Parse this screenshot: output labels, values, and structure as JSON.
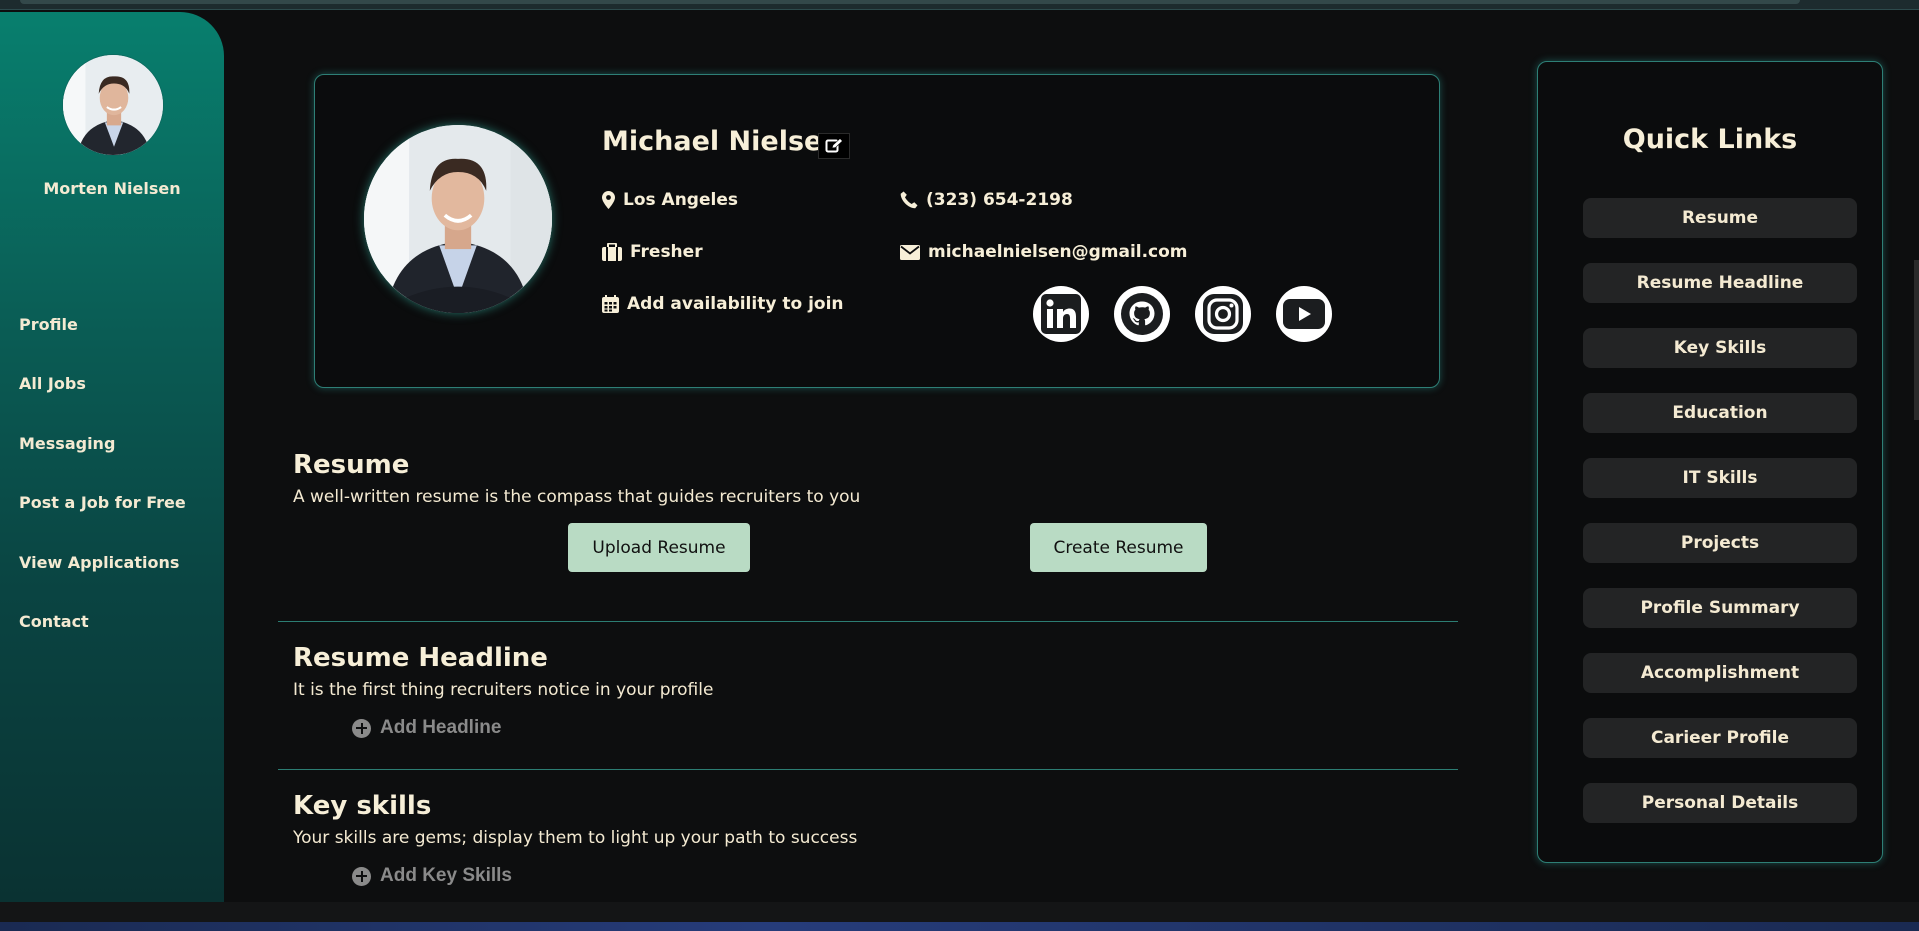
{
  "sidebar": {
    "user_name": "Morten Nielsen",
    "nav": [
      "Profile",
      "All Jobs",
      "Messaging",
      "Post a Job for Free",
      "View Applications",
      "Contact"
    ]
  },
  "profile": {
    "name": "Michael Nielsen",
    "location": "Los Angeles",
    "experience": "Fresher",
    "availability": "Add availability to join",
    "phone": "(323) 654-2198",
    "email": "michaelnielsen@gmail.com",
    "social_icons": [
      "linkedin-icon",
      "github-icon",
      "instagram-icon",
      "youtube-icon"
    ]
  },
  "sections": {
    "resume": {
      "title": "Resume",
      "subtitle": "A well-written resume is the compass that guides recruiters to you",
      "upload_label": "Upload Resume",
      "create_label": "Create Resume"
    },
    "headline": {
      "title": "Resume Headline",
      "subtitle": "It is the first thing recruiters notice in your profile",
      "add_label": "Add Headline"
    },
    "skills": {
      "title": "Key skills",
      "subtitle": "Your skills are gems; display them to light up your path to success",
      "add_label": "Add Key Skills"
    }
  },
  "quick_links": {
    "title": "Quick Links",
    "items": [
      "Resume",
      "Resume Headline",
      "Key Skills",
      "Education",
      "IT Skills",
      "Projects",
      "Profile Summary",
      "Accomplishment",
      "Carieer Profile",
      "Personal Details"
    ]
  },
  "colors": {
    "sidebar_top": "#087f6e",
    "sidebar_bottom": "#0a3232",
    "card_border": "#2e7f76",
    "button_green": "#b9dbc4",
    "text_cream": "#f4ead2",
    "background": "#0d0e0f"
  }
}
